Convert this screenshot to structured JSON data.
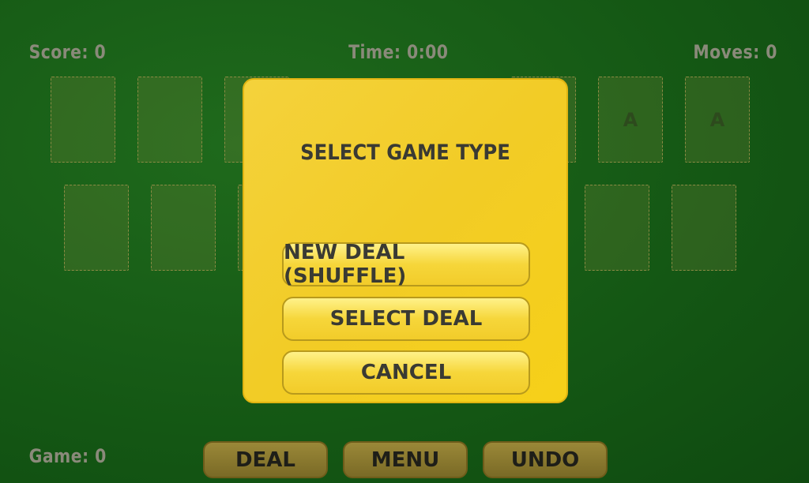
{
  "hud": {
    "score": "Score: 0",
    "time": "Time: 0:00",
    "moves": "Moves: 0",
    "game": "Game: 0"
  },
  "foundation_label": "A",
  "dialog": {
    "title": "SELECT GAME TYPE",
    "buttons": [
      "NEW DEAL (SHUFFLE)",
      "SELECT DEAL",
      "CANCEL"
    ]
  },
  "toolbar": {
    "deal": "DEAL",
    "menu": "MENU",
    "undo": "UNDO"
  }
}
